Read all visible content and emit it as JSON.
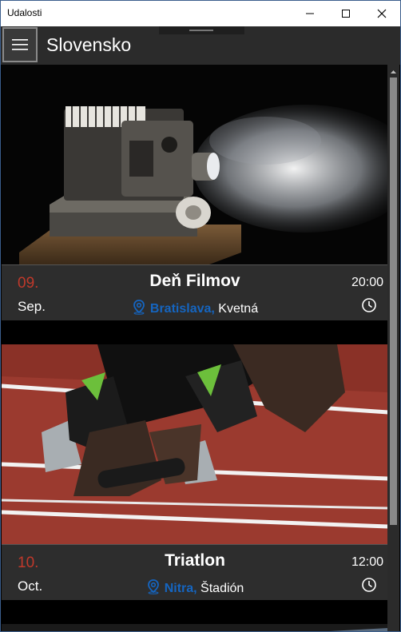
{
  "window": {
    "title": "Udalosti"
  },
  "appbar": {
    "title": "Slovensko",
    "menu_icon": "hamburger-icon"
  },
  "events": [
    {
      "day": "09.",
      "month": "Sep.",
      "name": "Deň Filmov",
      "city": "Bratislava,",
      "place": "Kvetná",
      "time": "20:00",
      "image": "film-projector"
    },
    {
      "day": "10.",
      "month": "Oct.",
      "name": "Triatlon",
      "city": "Nitra,",
      "place": "Štadión",
      "time": "12:00",
      "image": "runner-starting-blocks"
    }
  ],
  "colors": {
    "day": "#c0392b",
    "city": "#1565c0",
    "appbar": "#2b2b2b",
    "info_panel": "#2d2d2d"
  }
}
